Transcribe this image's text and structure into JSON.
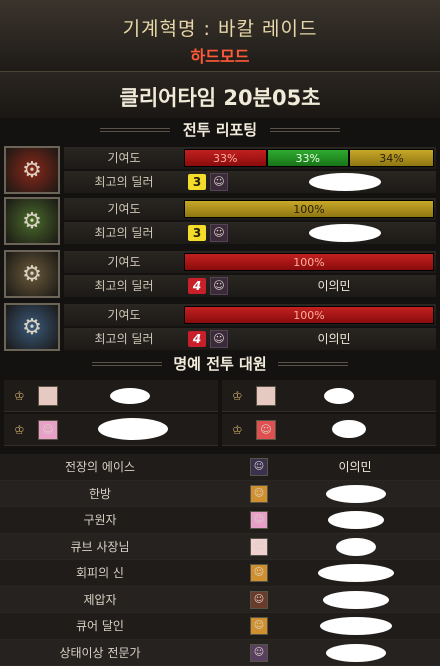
{
  "header": {
    "raid_title": "기계혁명 : 바칼 레이드",
    "mode": "하드모드"
  },
  "clear": {
    "label": "클리어타임  20분05초"
  },
  "report": {
    "section_title": "전투 리포팅",
    "contribution_label": "기여도",
    "best_dealer_label": "최고의 딜러",
    "bosses": [
      {
        "icon": "red-mech-boss-icon",
        "segments": [
          {
            "label": "33%",
            "value": 33,
            "color": "red"
          },
          {
            "label": "33%",
            "value": 33,
            "color": "green"
          },
          {
            "label": "34%",
            "value": 34,
            "color": "gold"
          }
        ],
        "dealer_rank": "3",
        "dealer_name": ""
      },
      {
        "icon": "green-mech-boss-icon",
        "segments": [
          {
            "label": "100%",
            "value": 100,
            "color": "gold"
          }
        ],
        "dealer_rank": "3",
        "dealer_name": ""
      },
      {
        "icon": "gold-mech-boss-icon",
        "segments": [
          {
            "label": "100%",
            "value": 100,
            "color": "red"
          }
        ],
        "dealer_rank": "4",
        "dealer_name": "이의민"
      },
      {
        "icon": "blue-mech-boss-icon",
        "segments": [
          {
            "label": "100%",
            "value": 100,
            "color": "red"
          }
        ],
        "dealer_rank": "4",
        "dealer_name": "이의민"
      }
    ]
  },
  "honor": {
    "section_title": "명예 전투 대원"
  },
  "awards": [
    {
      "title": "전장의 에이스",
      "name": "이의민"
    },
    {
      "title": "한방",
      "name": ""
    },
    {
      "title": "구원자",
      "name": ""
    },
    {
      "title": "큐브 사장님",
      "name": ""
    },
    {
      "title": "회피의 신",
      "name": ""
    },
    {
      "title": "제압자",
      "name": ""
    },
    {
      "title": "큐어 달인",
      "name": ""
    },
    {
      "title": "상태이상 전문가",
      "name": ""
    }
  ]
}
